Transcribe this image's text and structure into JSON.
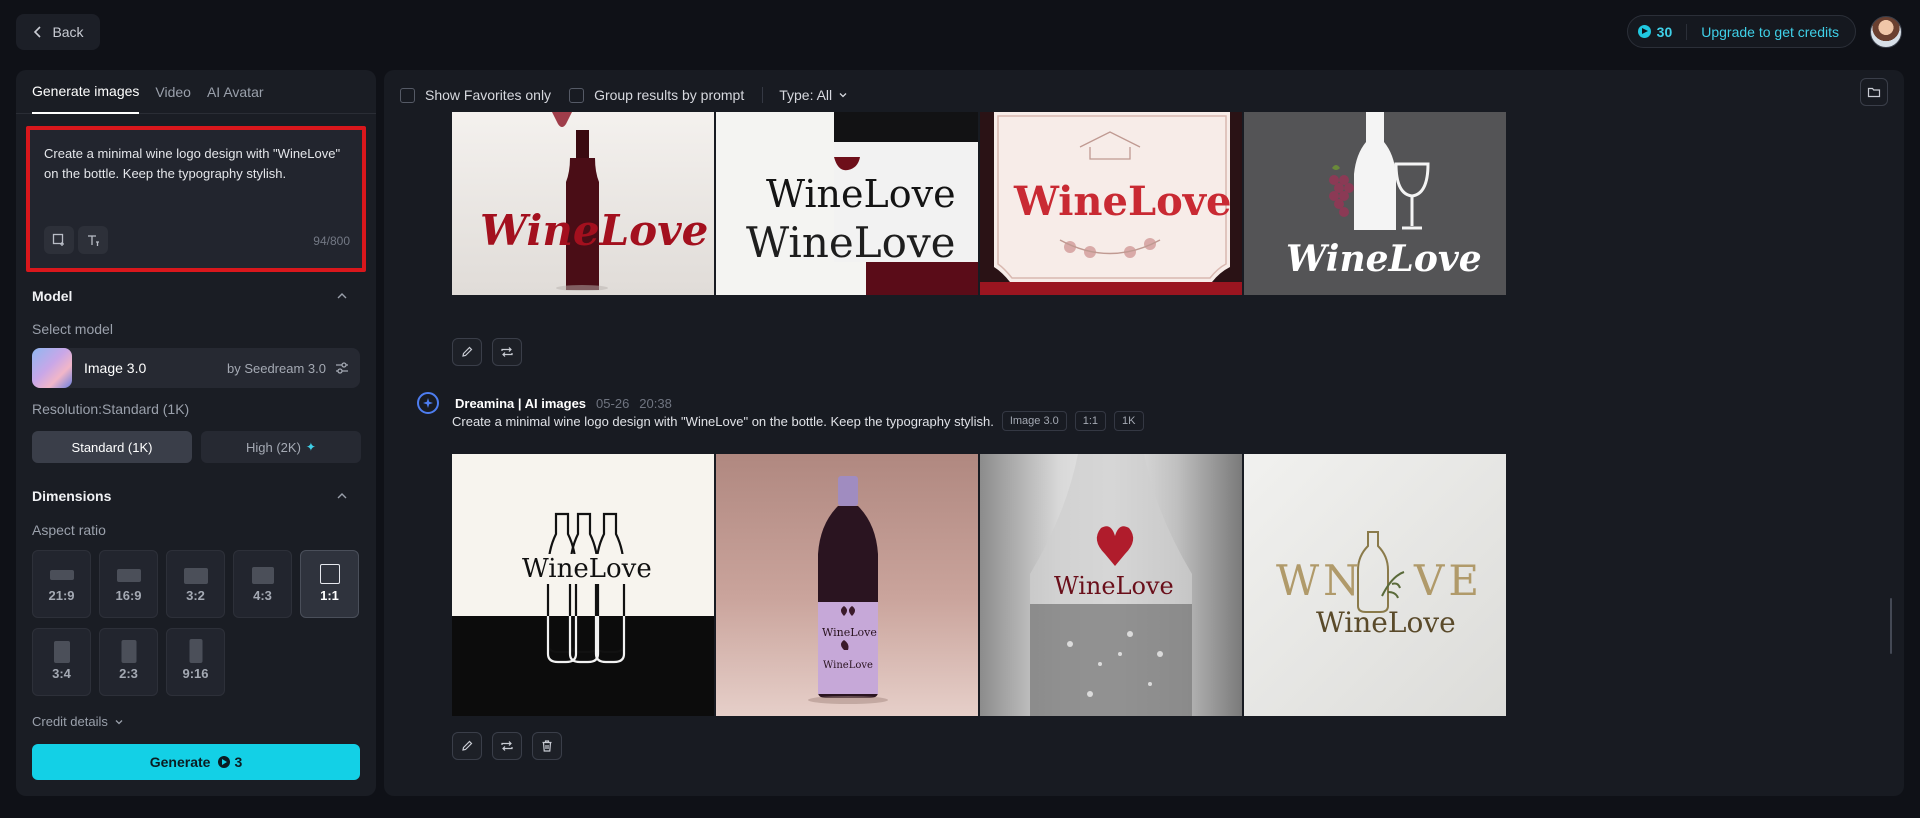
{
  "topbar": {
    "back_label": "Back",
    "credits": "30",
    "upgrade_label": "Upgrade to get credits"
  },
  "left": {
    "tabs": [
      "Generate images",
      "Video",
      "AI Avatar"
    ],
    "prompt": "Create a minimal wine logo design with \"WineLove\" on the bottle. Keep the typography stylish.",
    "prompt_counter": "94/800",
    "model_section": "Model",
    "select_model_label": "Select model",
    "model_name": "Image 3.0",
    "model_by": "by Seedream 3.0",
    "resolution_label": "Resolution:Standard (1K)",
    "res_standard": "Standard (1K)",
    "res_high": "High (2K)",
    "dimensions_section": "Dimensions",
    "aspect_label": "Aspect ratio",
    "ratios": [
      "21:9",
      "16:9",
      "3:2",
      "4:3",
      "1:1",
      "3:4",
      "2:3",
      "9:16"
    ],
    "selected_ratio": "1:1",
    "credit_details": "Credit details",
    "generate_label": "Generate",
    "generate_cost": "3"
  },
  "main": {
    "filters": {
      "favorites": "Show Favorites only",
      "group": "Group results by prompt",
      "type": "Type: All"
    },
    "top_images": [
      {
        "text": "WineLove"
      },
      {
        "text1": "WineLove",
        "text2": "WineLove"
      },
      {
        "text": "WineLove"
      },
      {
        "text": "WineLove"
      }
    ],
    "generation": {
      "author": "Dreamina | AI images",
      "date": "05-26",
      "time": "20:38",
      "prompt": "Create a minimal wine logo design with \"WineLove\" on the bottle. Keep the typography stylish.",
      "tags": [
        "Image 3.0",
        "1:1",
        "1K"
      ]
    },
    "bottom_images": [
      {
        "text": "WineLove"
      },
      {
        "text1": "WineLove",
        "text2": "WineLove"
      },
      {
        "text": "WineLove"
      },
      {
        "text1": "WN",
        "text2": "VE",
        "text3": "WineLove"
      }
    ]
  },
  "colors": {
    "accent": "#13d0e6",
    "highlight_border": "#d9171c",
    "background": "#0f1117",
    "panel": "#1a1d24"
  }
}
